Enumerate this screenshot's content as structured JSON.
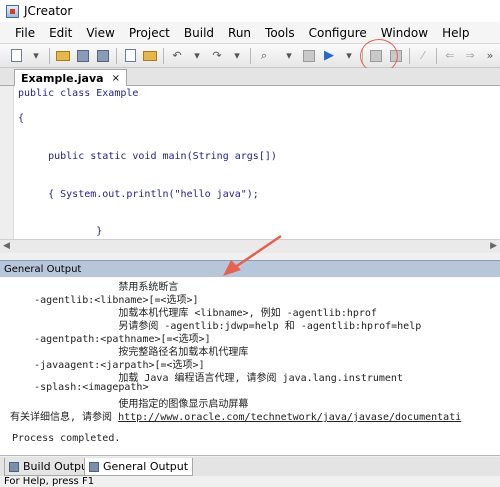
{
  "window": {
    "title": "JCreator"
  },
  "menu": [
    "File",
    "Edit",
    "View",
    "Project",
    "Build",
    "Run",
    "Tools",
    "Configure",
    "Window",
    "Help"
  ],
  "toolbar": {
    "icons": [
      "new-file-icon",
      "open-folder-icon",
      "save-icon",
      "save-all-icon",
      "copy-icon",
      "paste-icon",
      "undo-icon",
      "redo-icon",
      "find-icon",
      "build-icon",
      "run-icon",
      "debug-icon",
      "navigate-back-icon",
      "navigate-forward-icon"
    ]
  },
  "editor": {
    "tab_label": "Example.java",
    "tab_close": "×",
    "lines": [
      "public class Example",
      "{",
      "     public static void main(String args[])",
      "     { System.out.println(\"hello java\");",
      "             }"
    ]
  },
  "output": {
    "panel_title": "General Output",
    "lines": [
      "                  禁用系统断言",
      "    -agentlib:<libname>[=<选项>]",
      "                  加载本机代理库 <libname>, 例如 -agentlib:hprof",
      "                  另请参阅 -agentlib:jdwp=help 和 -agentlib:hprof=help",
      "    -agentpath:<pathname>[=<选项>]",
      "                  按完整路径名加载本机代理库",
      "    -javaagent:<jarpath>[=<选项>]",
      "                  加载 Java 编程语言代理, 请参阅 java.lang.instrument",
      "    -splash:<imagepath>",
      "                  使用指定的图像显示启动屏幕"
    ],
    "detail_prefix": "有关详细信息, 请参阅 ",
    "detail_link": "http://www.oracle.com/technetwork/java/javase/documentati",
    "completion": "Process completed."
  },
  "bottom_tabs": [
    "Build Output",
    "General Output"
  ],
  "status": "For Help, press F1",
  "colors": {
    "annotation": "#e6614f",
    "panel_header": "#b8c6dc",
    "code_text": "#1f1f8c"
  }
}
